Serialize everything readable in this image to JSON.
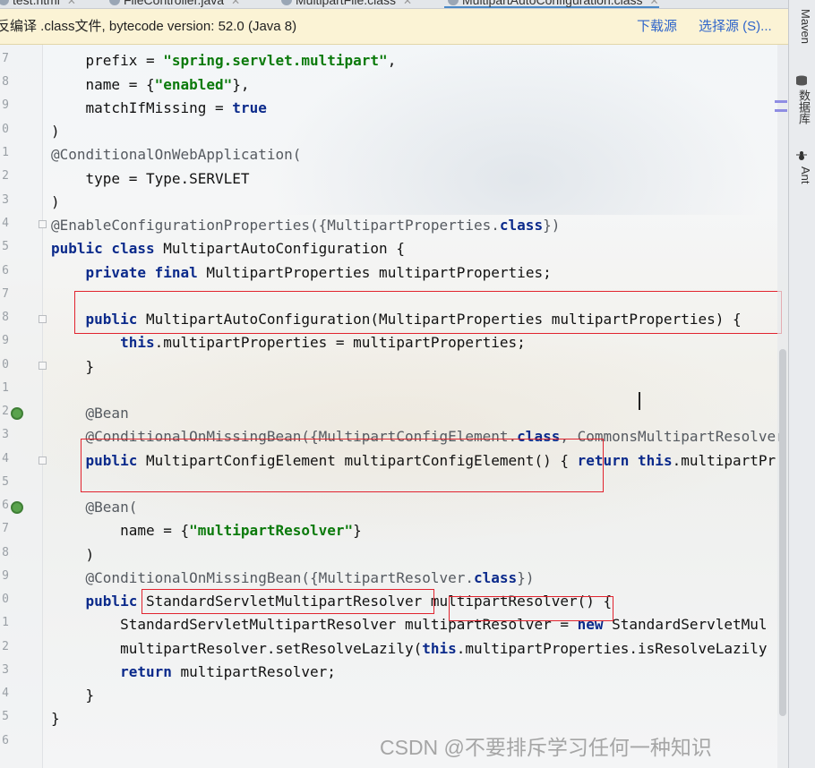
{
  "tabs": [
    {
      "label": "test.html",
      "active": false
    },
    {
      "label": "FileController.java",
      "active": false
    },
    {
      "label": "MultipartFile.class",
      "active": false
    },
    {
      "label": "MultipartAutoConfiguration.class",
      "active": true
    }
  ],
  "banner": {
    "message": "反编译 .class文件, bytecode version: 52.0 (Java 8)",
    "download_label": "下载源",
    "choose_label": "选择源 (S)..."
  },
  "right_toolbar": {
    "maven_label": "Maven",
    "database_label": "数据库",
    "ant_label": "Ant"
  },
  "gutter": {
    "line_numbers": [
      "7",
      "8",
      "9",
      "0",
      "1",
      "2",
      "3",
      "4",
      "5",
      "6",
      "7",
      "8",
      "9",
      "0",
      "1",
      "2",
      "3",
      "4",
      "5",
      "6",
      "7",
      "8",
      "9",
      "0",
      "1",
      "2",
      "3",
      "4",
      "5",
      "6",
      "7",
      "8"
    ]
  },
  "code": {
    "l1_a": "    prefix = ",
    "l1_b": "\"spring.servlet.multipart\"",
    "l1_c": ",",
    "l2_a": "    name = {",
    "l2_b": "\"enabled\"",
    "l2_c": "},",
    "l3_a": "    matchIfMissing = ",
    "l3_b": "true",
    "l4": ")",
    "l5": "@ConditionalOnWebApplication(",
    "l6": "    type = Type.SERVLET",
    "l7": ")",
    "l8_a": "@EnableConfigurationProperties({MultipartProperties.",
    "l8_b": "class",
    "l8_c": "})",
    "l9_a": "public class",
    "l9_b": " MultipartAutoConfiguration {",
    "l10_a": "    private final",
    "l10_b": " MultipartProperties multipartProperties;",
    "l12_a": "    public",
    "l12_b": " MultipartAutoConfiguration(MultipartProperties multipartProperties) {",
    "l13_a": "        this",
    "l13_b": ".multipartProperties = multipartProperties;",
    "l14": "    }",
    "l16": "    @Bean",
    "l17_a": "    @ConditionalOnMissingBean({MultipartConfigElement.",
    "l17_b": "class",
    "l17_c": ", CommonsMultipartResolver",
    "l18_a": "    public",
    "l18_b": " MultipartConfigElement multipartConfigElement() { ",
    "l18_c": "return this",
    "l18_d": ".multipartPr",
    "l20": "    @Bean(",
    "l21_a": "        name = {",
    "l21_b": "\"multipartResolver\"",
    "l21_c": "}",
    "l22": "    )",
    "l23_a": "    @ConditionalOnMissingBean({MultipartResolver.",
    "l23_b": "class",
    "l23_c": "})",
    "l24_a": "    public",
    "l24_b": " StandardServletMultipartResolver multipartResolver() {",
    "l25_a": "        StandardServletMultipartResolver multipartResolver = ",
    "l25_b": "new",
    "l25_c": " StandardServletMul",
    "l26_a": "        multipartResolver.setResolveLazily(",
    "l26_b": "this",
    "l26_c": ".multipartProperties.isResolveLazily",
    "l27_a": "        return",
    "l27_b": " multipartResolver;",
    "l28": "    }",
    "l29": "}"
  },
  "watermark": "CSDN @不要排斥学习任何一种知识",
  "colors": {
    "keyword": "#0b2a8b",
    "string": "#0b7a0b",
    "highlight_box": "#e1232e",
    "banner_bg": "#fbf3d5",
    "link": "#2f65ca"
  }
}
